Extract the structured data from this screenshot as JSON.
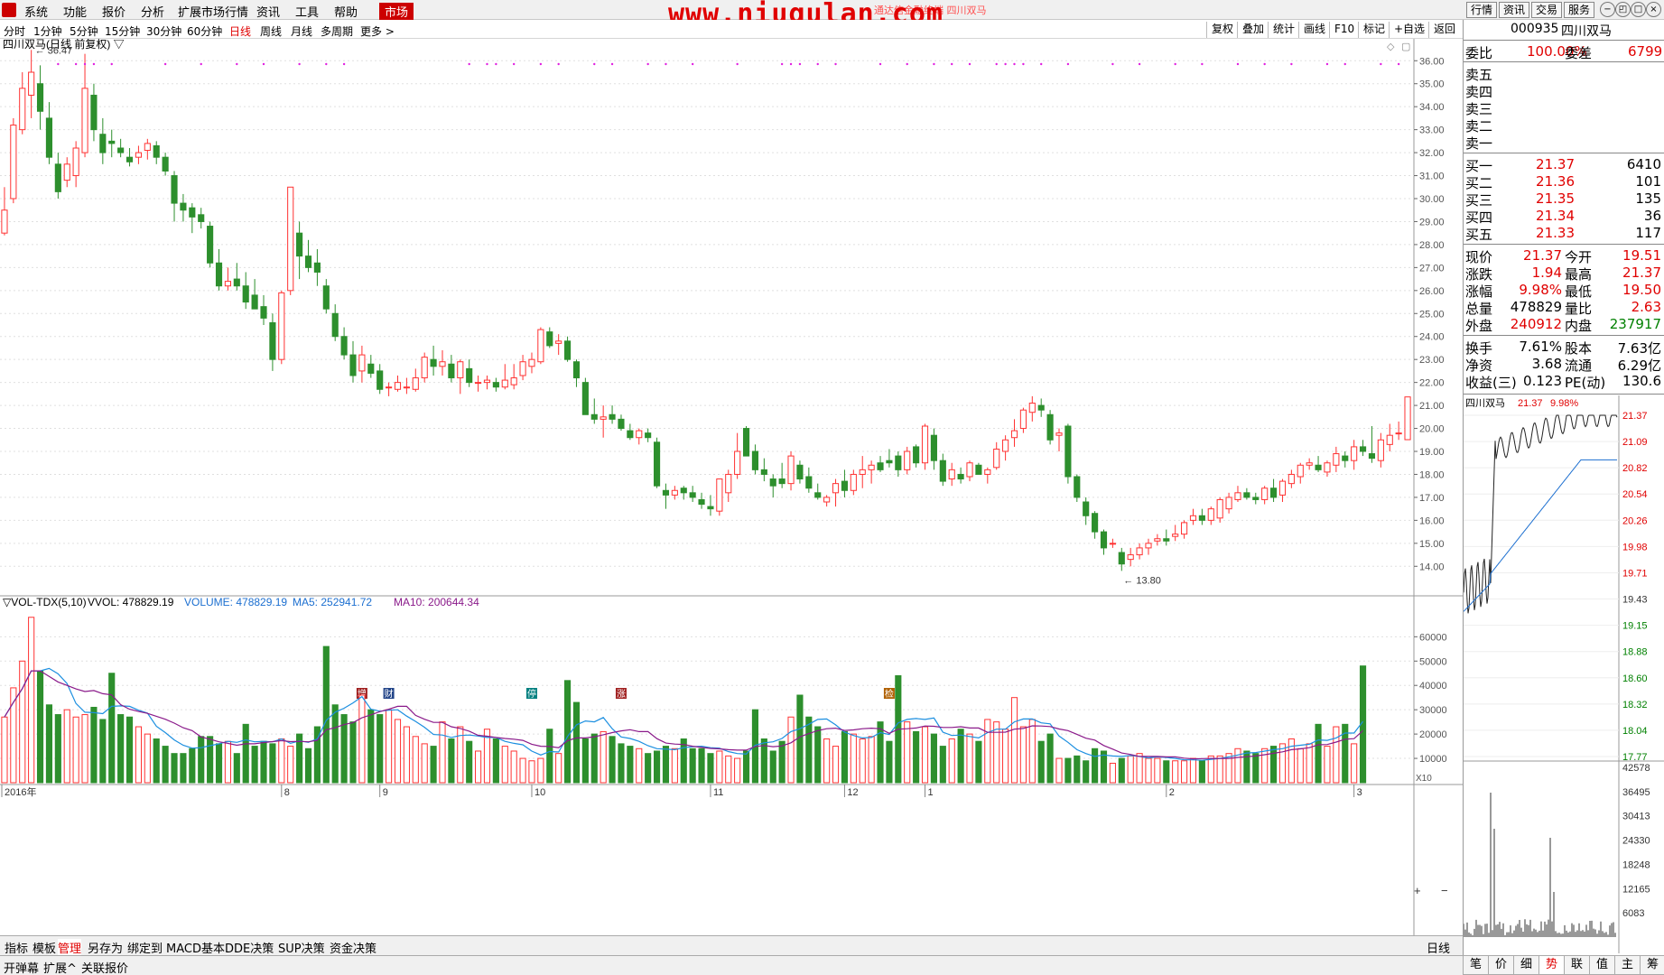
{
  "menubar": {
    "items": [
      "系统",
      "功能",
      "报价",
      "分析",
      "扩展市场行情",
      "资讯",
      "工具",
      "帮助"
    ],
    "active": "市场",
    "watermark": "www.niugulan.com",
    "title_small": "通达信金融终端 四川双马",
    "right_buttons": [
      "行情",
      "资讯",
      "交易",
      "服务"
    ],
    "window_controls": [
      "−",
      "◰",
      "□",
      "×"
    ]
  },
  "periods": [
    "分时",
    "1分钟",
    "5分钟",
    "15分钟",
    "30分钟",
    "60分钟",
    "日线",
    "周线",
    "月线",
    "多周期",
    "更多 >"
  ],
  "active_period": "日线",
  "toolbar": [
    "复权",
    "叠加",
    "统计",
    "画线",
    "F10",
    "标记",
    "+自选",
    "返回"
  ],
  "chart_header": "四川双马(日线 前复权) ▽",
  "vol_header": {
    "name": "▽VOL-TDX(5,10)",
    "vvol": "VVOL: 478829.19",
    "volume": "VOLUME: 478829.19",
    "ma5": "MA5: 252941.72",
    "ma10": "MA10: 200644.34"
  },
  "colors": {
    "up": "#ff3232",
    "down": "#2d8f2d",
    "ma5": "#1c8fe0",
    "ma10": "#8a1a8a",
    "grid": "#e0e0e0"
  },
  "chart_data": {
    "type": "candlestick",
    "ylim": [
      13.5,
      36.6
    ],
    "yticks": [
      "36.00",
      "35.00",
      "34.00",
      "33.00",
      "32.00",
      "31.00",
      "30.00",
      "29.00",
      "28.00",
      "27.00",
      "26.00",
      "25.00",
      "24.00",
      "23.00",
      "22.00",
      "21.00",
      "20.00",
      "19.00",
      "18.00",
      "17.00",
      "16.00",
      "15.00",
      "14.00"
    ],
    "high_label": "36.47",
    "low_label": "13.80",
    "x_labels": [
      "2016年",
      "8",
      "9",
      "10",
      "11",
      "12",
      "1",
      "2",
      "3"
    ],
    "ohlc": [
      [
        28.5,
        30.5,
        28.4,
        29.5
      ],
      [
        30.0,
        33.5,
        29.8,
        33.2
      ],
      [
        33.0,
        35.5,
        32.8,
        34.8
      ],
      [
        34.5,
        36.47,
        33.5,
        35.5
      ],
      [
        35.0,
        35.8,
        33.0,
        33.8
      ],
      [
        33.5,
        34.2,
        31.5,
        31.8
      ],
      [
        31.5,
        32.0,
        30.0,
        30.3
      ],
      [
        30.8,
        31.8,
        30.5,
        31.5
      ],
      [
        31.0,
        32.5,
        30.5,
        32.2
      ],
      [
        32.0,
        36.3,
        31.8,
        34.8
      ],
      [
        34.5,
        35.0,
        32.5,
        33.0
      ],
      [
        32.8,
        33.5,
        31.5,
        32.0
      ],
      [
        32.5,
        33.0,
        31.8,
        32.4
      ],
      [
        32.2,
        32.6,
        31.8,
        32.0
      ],
      [
        31.8,
        32.2,
        31.4,
        31.6
      ],
      [
        31.8,
        32.3,
        31.5,
        32.0
      ],
      [
        32.1,
        32.6,
        31.7,
        32.4
      ],
      [
        32.3,
        32.5,
        31.5,
        31.8
      ],
      [
        31.8,
        32.0,
        31.0,
        31.2
      ],
      [
        31.0,
        31.2,
        29.0,
        29.8
      ],
      [
        29.8,
        30.2,
        29.0,
        29.5
      ],
      [
        29.6,
        29.8,
        28.5,
        29.2
      ],
      [
        29.3,
        29.6,
        28.7,
        29.0
      ],
      [
        28.8,
        29.0,
        27.0,
        27.2
      ],
      [
        27.2,
        27.8,
        26.0,
        26.2
      ],
      [
        26.2,
        27.0,
        26.0,
        26.4
      ],
      [
        26.5,
        27.2,
        26.0,
        26.2
      ],
      [
        26.2,
        26.8,
        25.2,
        25.5
      ],
      [
        25.8,
        26.5,
        25.2,
        25.2
      ],
      [
        25.3,
        25.8,
        24.5,
        24.8
      ],
      [
        24.6,
        25.0,
        22.5,
        23.0
      ],
      [
        23.0,
        26.0,
        22.8,
        25.9
      ],
      [
        26.0,
        30.5,
        25.8,
        30.5
      ],
      [
        28.5,
        29.0,
        26.5,
        27.5
      ],
      [
        27.5,
        28.2,
        26.8,
        27.0
      ],
      [
        27.2,
        27.8,
        26.2,
        26.8
      ],
      [
        26.2,
        26.5,
        25.0,
        25.2
      ],
      [
        25.0,
        25.4,
        23.8,
        24.0
      ],
      [
        24.0,
        24.4,
        23.0,
        23.2
      ],
      [
        23.2,
        23.8,
        22.0,
        22.3
      ],
      [
        22.5,
        23.6,
        22.0,
        23.2
      ],
      [
        22.8,
        23.2,
        22.2,
        22.4
      ],
      [
        22.5,
        22.8,
        21.5,
        21.7
      ],
      [
        21.8,
        22.0,
        21.4,
        21.8
      ],
      [
        21.7,
        22.3,
        21.6,
        22.0
      ],
      [
        21.8,
        22.2,
        21.5,
        21.8
      ],
      [
        21.7,
        22.6,
        21.6,
        22.2
      ],
      [
        22.2,
        23.3,
        22.0,
        23.1
      ],
      [
        23.0,
        23.6,
        22.3,
        22.7
      ],
      [
        22.7,
        23.4,
        22.3,
        22.9
      ],
      [
        22.8,
        23.2,
        22.0,
        22.2
      ],
      [
        22.2,
        23.0,
        21.5,
        22.9
      ],
      [
        22.6,
        23.0,
        21.8,
        22.0
      ],
      [
        22.0,
        22.3,
        21.6,
        22.0
      ],
      [
        22.0,
        22.3,
        21.7,
        22.1
      ],
      [
        22.0,
        22.2,
        21.6,
        21.8
      ],
      [
        21.8,
        22.8,
        21.7,
        22.1
      ],
      [
        21.9,
        22.8,
        21.7,
        22.2
      ],
      [
        22.3,
        23.2,
        22.1,
        22.9
      ],
      [
        22.7,
        23.3,
        22.4,
        23.0
      ],
      [
        22.9,
        24.4,
        22.8,
        24.3
      ],
      [
        24.2,
        24.4,
        23.5,
        23.6
      ],
      [
        23.7,
        24.1,
        23.2,
        23.8
      ],
      [
        23.8,
        24.0,
        22.9,
        23.0
      ],
      [
        22.9,
        23.0,
        21.8,
        22.2
      ],
      [
        22.0,
        22.2,
        20.6,
        20.6
      ],
      [
        20.6,
        21.3,
        20.2,
        20.4
      ],
      [
        20.4,
        21.0,
        19.6,
        20.5
      ],
      [
        20.6,
        21.0,
        20.2,
        20.4
      ],
      [
        20.4,
        20.6,
        19.9,
        20.0
      ],
      [
        19.9,
        20.2,
        19.5,
        19.6
      ],
      [
        19.6,
        20.0,
        19.3,
        19.9
      ],
      [
        19.8,
        20.0,
        19.4,
        19.6
      ],
      [
        19.4,
        19.6,
        17.4,
        17.5
      ],
      [
        17.3,
        17.6,
        16.5,
        17.1
      ],
      [
        17.1,
        17.5,
        16.9,
        17.3
      ],
      [
        17.4,
        17.5,
        16.9,
        17.2
      ],
      [
        17.2,
        17.5,
        16.8,
        17.0
      ],
      [
        16.9,
        17.2,
        16.5,
        16.7
      ],
      [
        16.6,
        17.1,
        16.2,
        16.5
      ],
      [
        16.4,
        17.8,
        16.2,
        17.8
      ],
      [
        17.2,
        18.2,
        16.8,
        18.0
      ],
      [
        18.0,
        19.8,
        17.8,
        19.0
      ],
      [
        20.0,
        20.1,
        18.8,
        18.8
      ],
      [
        19.0,
        19.3,
        18.0,
        18.2
      ],
      [
        18.2,
        18.7,
        17.7,
        18.0
      ],
      [
        17.8,
        18.0,
        17.0,
        17.5
      ],
      [
        17.8,
        18.5,
        17.4,
        17.6
      ],
      [
        17.6,
        19.0,
        17.3,
        18.8
      ],
      [
        18.4,
        18.6,
        17.6,
        17.8
      ],
      [
        17.9,
        18.3,
        17.2,
        17.4
      ],
      [
        17.2,
        17.6,
        16.9,
        17.0
      ],
      [
        16.8,
        17.1,
        16.6,
        17.0
      ],
      [
        17.2,
        17.8,
        16.6,
        17.6
      ],
      [
        17.7,
        18.2,
        17.0,
        17.3
      ],
      [
        17.3,
        18.2,
        17.1,
        18.0
      ],
      [
        18.0,
        18.8,
        17.4,
        18.2
      ],
      [
        18.2,
        18.6,
        17.6,
        18.4
      ],
      [
        18.5,
        18.8,
        18.1,
        18.2
      ],
      [
        18.6,
        19.1,
        18.3,
        18.5
      ],
      [
        18.8,
        19.0,
        17.9,
        18.2
      ],
      [
        18.2,
        19.2,
        18.0,
        19.0
      ],
      [
        19.2,
        19.3,
        18.3,
        18.5
      ],
      [
        18.5,
        20.2,
        18.2,
        20.1
      ],
      [
        19.7,
        20.0,
        18.2,
        18.6
      ],
      [
        18.6,
        18.9,
        17.5,
        17.7
      ],
      [
        17.8,
        18.5,
        17.5,
        18.2
      ],
      [
        18.0,
        18.3,
        17.6,
        17.8
      ],
      [
        17.9,
        18.6,
        17.7,
        18.5
      ],
      [
        18.4,
        18.5,
        18.0,
        18.0
      ],
      [
        18.0,
        18.3,
        17.6,
        18.2
      ],
      [
        18.3,
        19.4,
        18.2,
        19.1
      ],
      [
        19.0,
        19.7,
        18.6,
        19.5
      ],
      [
        19.6,
        20.4,
        19.2,
        19.9
      ],
      [
        20.0,
        20.9,
        19.8,
        20.8
      ],
      [
        20.7,
        21.4,
        20.3,
        21.1
      ],
      [
        21.0,
        21.3,
        20.5,
        20.8
      ],
      [
        20.6,
        20.8,
        19.3,
        19.5
      ],
      [
        19.7,
        20.0,
        19.0,
        19.8
      ],
      [
        20.1,
        20.2,
        17.6,
        17.9
      ],
      [
        17.9,
        18.0,
        16.8,
        17.0
      ],
      [
        16.8,
        17.0,
        15.8,
        16.2
      ],
      [
        16.3,
        16.4,
        15.2,
        15.5
      ],
      [
        15.5,
        15.6,
        14.5,
        14.8
      ],
      [
        15.0,
        15.2,
        14.8,
        15.0
      ],
      [
        14.6,
        14.8,
        13.8,
        14.1
      ],
      [
        14.3,
        14.8,
        14.0,
        14.5
      ],
      [
        14.5,
        15.0,
        14.3,
        14.8
      ],
      [
        14.8,
        15.2,
        14.5,
        15.0
      ],
      [
        15.1,
        15.4,
        14.9,
        15.2
      ],
      [
        15.2,
        15.6,
        14.9,
        15.1
      ],
      [
        15.3,
        15.8,
        15.1,
        15.4
      ],
      [
        15.4,
        16.0,
        15.2,
        15.9
      ],
      [
        16.0,
        16.5,
        15.8,
        16.2
      ],
      [
        16.2,
        16.5,
        15.8,
        16.0
      ],
      [
        16.0,
        16.6,
        15.8,
        16.5
      ],
      [
        16.1,
        17.0,
        15.9,
        16.9
      ],
      [
        16.5,
        17.2,
        16.3,
        17.0
      ],
      [
        16.9,
        17.5,
        16.8,
        17.2
      ],
      [
        17.2,
        17.4,
        16.9,
        17.0
      ],
      [
        17.0,
        17.2,
        16.7,
        16.9
      ],
      [
        16.9,
        17.5,
        16.7,
        17.4
      ],
      [
        17.4,
        17.8,
        16.8,
        17.0
      ],
      [
        17.1,
        17.8,
        16.8,
        17.7
      ],
      [
        17.6,
        18.2,
        17.4,
        18.0
      ],
      [
        17.9,
        18.5,
        17.6,
        18.4
      ],
      [
        18.4,
        18.7,
        18.2,
        18.5
      ],
      [
        18.4,
        18.8,
        18.1,
        18.2
      ],
      [
        18.1,
        18.6,
        17.9,
        18.5
      ],
      [
        18.4,
        19.2,
        18.1,
        18.9
      ],
      [
        18.8,
        19.0,
        18.3,
        18.6
      ],
      [
        18.6,
        19.5,
        18.2,
        19.2
      ],
      [
        19.2,
        19.5,
        18.8,
        19.0
      ],
      [
        18.9,
        20.1,
        18.5,
        18.7
      ],
      [
        18.6,
        19.8,
        18.3,
        19.5
      ],
      [
        19.3,
        20.2,
        19.0,
        19.7
      ],
      [
        19.8,
        20.3,
        19.5,
        19.8
      ],
      [
        19.51,
        21.37,
        19.5,
        21.37
      ]
    ],
    "volume": {
      "ylim": [
        0,
        72000
      ],
      "yticks": [
        "60000",
        "50000",
        "40000",
        "30000",
        "20000",
        "10000"
      ],
      "values": [
        27000,
        39000,
        50000,
        68000,
        46000,
        32000,
        28000,
        30000,
        27000,
        28000,
        31000,
        26000,
        45000,
        28000,
        27000,
        23000,
        20000,
        18000,
        15000,
        12000,
        12000,
        14000,
        19000,
        19000,
        16000,
        17000,
        12000,
        24000,
        15000,
        17000,
        16000,
        18000,
        15000,
        20000,
        14000,
        23000,
        56000,
        32000,
        28000,
        25000,
        36000,
        30000,
        28000,
        30000,
        26000,
        23000,
        19000,
        16000,
        15000,
        25000,
        18000,
        23000,
        17000,
        13000,
        22000,
        18000,
        15000,
        13000,
        10000,
        9000,
        10000,
        22000,
        12000,
        42000,
        33000,
        18000,
        20000,
        21000,
        19000,
        16000,
        15000,
        14000,
        12000,
        13000,
        15000,
        14000,
        18000,
        14000,
        14000,
        12000,
        13000,
        11000,
        10000,
        13000,
        30000,
        18000,
        13000,
        17000,
        27000,
        36000,
        27000,
        23000,
        18000,
        15000,
        21000,
        20000,
        18000,
        19000,
        25000,
        17000,
        44000,
        25000,
        21000,
        23000,
        20000,
        15000,
        18000,
        22000,
        20000,
        17000,
        26000,
        25000,
        22000,
        35000,
        23000,
        26000,
        17000,
        20000,
        10000,
        10000,
        11000,
        9000,
        14000,
        13000,
        8000,
        10000,
        11000,
        12000,
        10000,
        10000,
        9000,
        9000,
        9000,
        10000,
        9000,
        11000,
        11000,
        12000,
        14000,
        13000,
        12000,
        14000,
        15000,
        16000,
        18000,
        14000,
        16000,
        24000,
        15000,
        23000,
        24000,
        16000,
        48000
      ]
    }
  },
  "right_panel": {
    "code": "000935",
    "name": "四川双马",
    "weibi_label": "委比",
    "weibi": "100.00%",
    "weicha_label": "委差",
    "weicha": "6799",
    "sell": [
      {
        "label": "卖五",
        "price": "",
        "vol": ""
      },
      {
        "label": "卖四",
        "price": "",
        "vol": ""
      },
      {
        "label": "卖三",
        "price": "",
        "vol": ""
      },
      {
        "label": "卖二",
        "price": "",
        "vol": ""
      },
      {
        "label": "卖一",
        "price": "",
        "vol": ""
      }
    ],
    "buy": [
      {
        "label": "买一",
        "price": "21.37",
        "vol": "6410"
      },
      {
        "label": "买二",
        "price": "21.36",
        "vol": "101"
      },
      {
        "label": "买三",
        "price": "21.35",
        "vol": "135"
      },
      {
        "label": "买四",
        "price": "21.34",
        "vol": "36"
      },
      {
        "label": "买五",
        "price": "21.33",
        "vol": "117"
      }
    ],
    "quote": [
      {
        "l1": "现价",
        "v1": "21.37",
        "c1": "red",
        "l2": "今开",
        "v2": "19.51",
        "c2": "red"
      },
      {
        "l1": "涨跌",
        "v1": "1.94",
        "c1": "red",
        "l2": "最高",
        "v2": "21.37",
        "c2": "red"
      },
      {
        "l1": "涨幅",
        "v1": "9.98%",
        "c1": "red",
        "l2": "最低",
        "v2": "19.50",
        "c2": "red"
      },
      {
        "l1": "总量",
        "v1": "478829",
        "c1": "",
        "l2": "量比",
        "v2": "2.63",
        "c2": "red"
      },
      {
        "l1": "外盘",
        "v1": "240912",
        "c1": "red",
        "l2": "内盘",
        "v2": "237917",
        "c2": "green"
      }
    ],
    "finance": [
      {
        "l1": "换手",
        "v1": "7.61%",
        "l2": "股本",
        "v2": "7.63亿"
      },
      {
        "l1": "净资",
        "v1": "3.68",
        "l2": "流通",
        "v2": "6.29亿"
      },
      {
        "l1": "收益(三)",
        "v1": "0.123",
        "l2": "PE(动)",
        "v2": "130.6"
      }
    ],
    "mini_title": "四川双马",
    "mini_price": "21.37",
    "mini_pct": "9.98%",
    "mini_price_ticks": [
      "21.37",
      "21.09",
      "20.82",
      "20.54",
      "20.26",
      "19.98",
      "19.71",
      "19.43",
      "19.15",
      "18.88",
      "18.60",
      "18.32",
      "18.04",
      "17.77"
    ],
    "mini_vol_ticks": [
      "42578",
      "36495",
      "30413",
      "24330",
      "18248",
      "12165",
      "6083"
    ]
  },
  "bottom_tabs": [
    "指标",
    "模板",
    "管理",
    "另存为",
    "绑定到",
    "MACD基本",
    "DDE决策",
    "SUP决策",
    "资金决策"
  ],
  "bottom_active": "管理",
  "bottom_right": "日线",
  "status_items": [
    "开弹幕",
    "扩展^",
    "关联报价"
  ],
  "side_tabs": [
    "笔",
    "价",
    "细",
    "势",
    "联",
    "值",
    "主",
    "筹"
  ],
  "side_active": "势",
  "event_markers": [
    {
      "label": "增",
      "color": "#a02020"
    },
    {
      "label": "财",
      "color": "#224488"
    },
    {
      "label": "停",
      "color": "#008080"
    },
    {
      "label": "涨",
      "color": "#a02020"
    },
    {
      "label": "检",
      "color": "#b06000"
    }
  ]
}
